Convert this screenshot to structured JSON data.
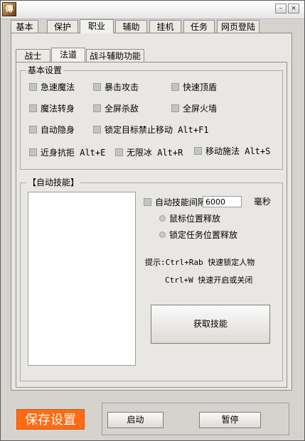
{
  "window": {
    "app_icon_text": "傳",
    "minimize_glyph": "–",
    "close_glyph": "×"
  },
  "tabs": [
    {
      "label": "基本"
    },
    {
      "label": "保护"
    },
    {
      "label": "职业",
      "active": true
    },
    {
      "label": "辅助"
    },
    {
      "label": "挂机"
    },
    {
      "label": "任务"
    },
    {
      "label": "网页登陆"
    }
  ],
  "subtabs": [
    {
      "label": "战士"
    },
    {
      "label": "法道",
      "active": true
    },
    {
      "label": "战斗辅助功能"
    }
  ],
  "basic_settings": {
    "legend": "基本设置",
    "options": [
      {
        "label": "急速魔法"
      },
      {
        "label": "暴击攻击"
      },
      {
        "label": "快速顶盾"
      },
      {
        "label": "魔法转身"
      },
      {
        "label": "全屏杀敌"
      },
      {
        "label": "全屏火墙"
      },
      {
        "label": "自动隐身"
      },
      {
        "label": "锁定目标禁止移动 Alt+F1"
      },
      {
        "label": "近身抗拒 Alt+E"
      },
      {
        "label": "无限冰 Alt+R"
      },
      {
        "label": "移动施法 Alt+S"
      }
    ]
  },
  "auto_skill": {
    "legend": "【自动技能】",
    "interval_label": "自动技能间隔",
    "interval_value": "6000",
    "interval_unit": "毫秒",
    "radio_mouse": "鼠标位置释放",
    "radio_task": "锁定任务位置释放",
    "hint_line1": "提示:Ctrl+Rab 快速锁定人物",
    "hint_line2": "Ctrl+W 快速开启或关闭",
    "get_skills_button": "获取技能"
  },
  "footer": {
    "save_button": "保存设置",
    "start_button": "启动",
    "pause_button": "暂停"
  }
}
